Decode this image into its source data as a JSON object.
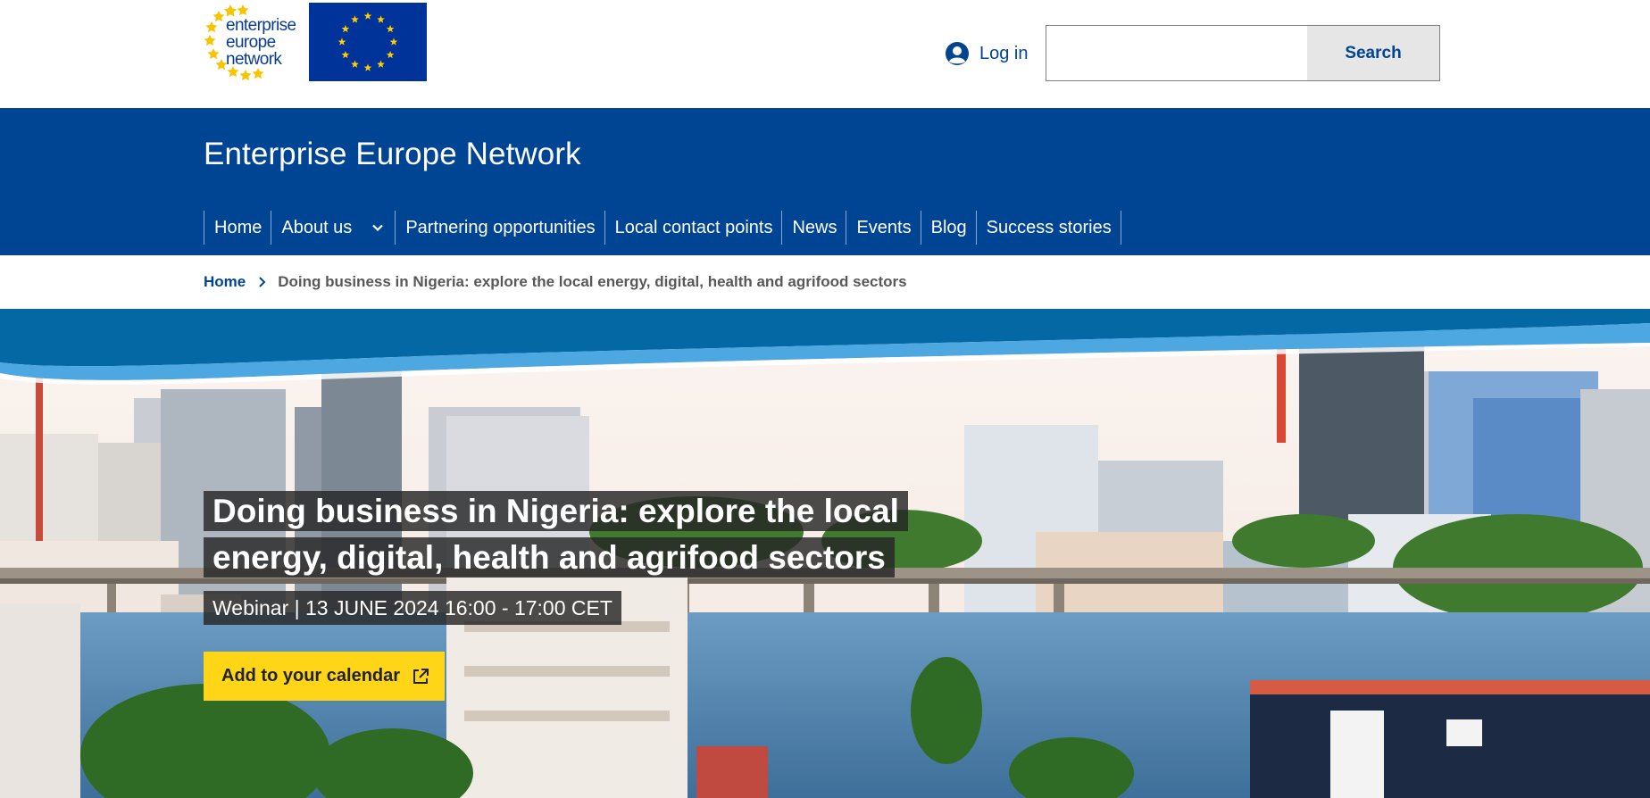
{
  "header": {
    "logo_lines": [
      "enterprise",
      "europe",
      "network"
    ],
    "login_label": "Log in",
    "search": {
      "value": "",
      "placeholder": "",
      "button_label": "Search"
    }
  },
  "site": {
    "name": "Enterprise Europe Network",
    "nav": [
      {
        "label": "Home"
      },
      {
        "label": "About us",
        "has_dropdown": true
      },
      {
        "label": "Partnering opportunities"
      },
      {
        "label": "Local contact points"
      },
      {
        "label": "News"
      },
      {
        "label": "Events"
      },
      {
        "label": "Blog"
      },
      {
        "label": "Success stories"
      }
    ]
  },
  "breadcrumb": {
    "home": "Home",
    "current": "Doing business in Nigeria: explore the local energy, digital, health and agrifood sectors"
  },
  "hero": {
    "title_line1": "Doing business in Nigeria: explore the local",
    "title_line2": "energy, digital, health and agrifood sectors",
    "subtitle": "Webinar | 13 JUNE 2024 16:00 - 17:00 CET",
    "calendar_button": "Add to your calendar"
  },
  "colors": {
    "primary_blue": "#004494",
    "accent_yellow": "#ffd617",
    "eu_blue": "#003399",
    "eu_star": "#ffcc00"
  },
  "icons": {
    "login": "user-circle-icon",
    "dropdown": "chevron-down-icon",
    "breadcrumb_separator": "chevron-right-icon",
    "calendar_external": "external-link-icon"
  }
}
